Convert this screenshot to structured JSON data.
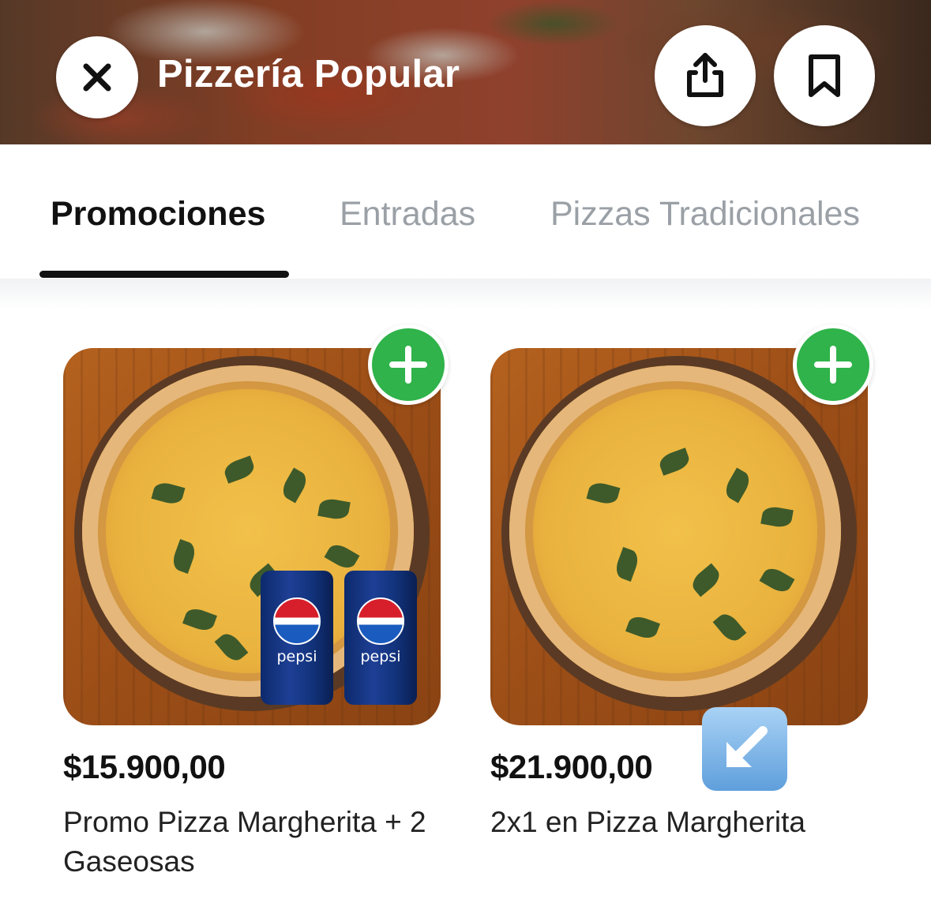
{
  "header": {
    "title": "Pizzería Popular",
    "close_icon": "close-icon",
    "share_icon": "share-icon",
    "bookmark_icon": "bookmark-icon"
  },
  "tabs": [
    {
      "label": "Promociones",
      "active": true
    },
    {
      "label": "Entradas",
      "active": false
    },
    {
      "label": "Pizzas Tradicionales",
      "active": false
    }
  ],
  "products": [
    {
      "price": "$15.900,00",
      "name": "Promo Pizza Margherita + 2 Gaseosas",
      "image": "pizza-margherita-with-2-pepsi-cans",
      "can_label": "pepsi",
      "add_icon": "plus-icon"
    },
    {
      "price": "$21.900,00",
      "name": "2x1 en Pizza Margherita",
      "image": "pizza-margherita",
      "add_icon": "plus-icon",
      "emoji": "down-left-arrow-icon"
    }
  ],
  "colors": {
    "add_button": "#2fb34a",
    "active_tab": "#111111",
    "inactive_tab": "#9aa0a6"
  }
}
